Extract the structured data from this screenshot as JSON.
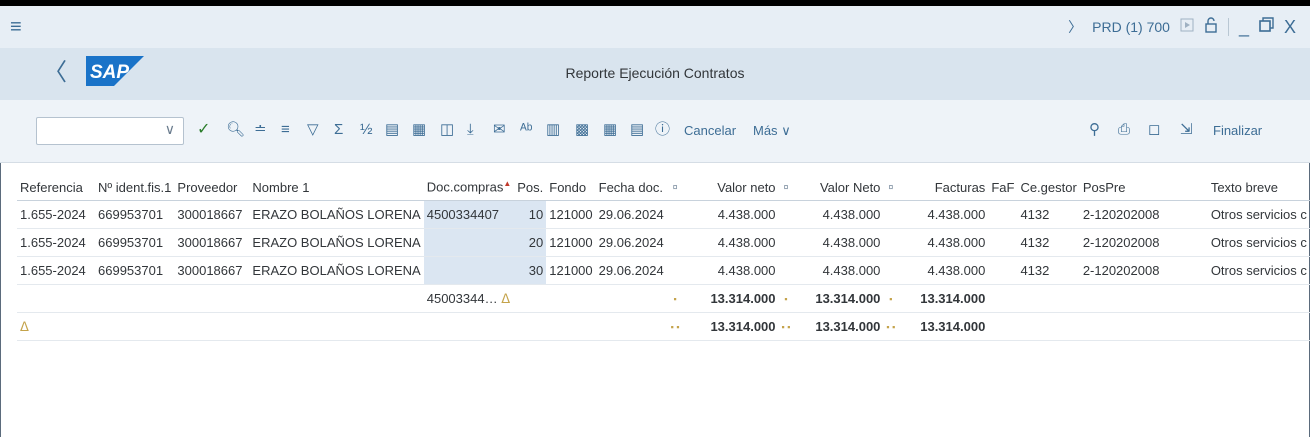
{
  "system": {
    "menu_icon": "hamburger-menu-icon",
    "chevron": "〉",
    "system_id": "PRD (1) 700",
    "icons": [
      "play-icon",
      "unlock-icon",
      "minimize-icon",
      "restore-icon",
      "close-icon"
    ],
    "minimize_glyph": "_",
    "close_glyph": "X"
  },
  "titlebar": {
    "back_glyph": "〈",
    "logo_text": "SAP",
    "title": "Reporte Ejecución Contratos"
  },
  "toolbar": {
    "command_value": "",
    "dropdown_glyph": "∨",
    "icons": [
      "check-icon",
      "find-icon",
      "sort-asc-icon",
      "sort-desc-icon",
      "filter-icon",
      "sum-icon",
      "subtotal-icon",
      "print-preview-icon",
      "export-icon",
      "word-icon",
      "download-icon",
      "email-icon",
      "abc-icon",
      "chart-icon",
      "grid-icon",
      "layout-icon",
      "variant-icon",
      "info-icon"
    ],
    "cancel_label": "Cancelar",
    "more_label": "Más",
    "more_chevron": "∨",
    "right_icons": [
      "search-icon",
      "print-icon",
      "screen-icon",
      "exit-icon"
    ],
    "exit_label": "Finalizar"
  },
  "table": {
    "columns": [
      "Referencia",
      "Nº ident.fis.1",
      "Proveedor",
      "Nombre 1",
      "Doc.compras",
      "Pos.",
      "Fondo",
      "Fecha doc.",
      "",
      "Valor neto",
      "",
      "Valor Neto",
      "",
      "Facturas",
      "FaF",
      "Ce.gestor",
      "PosPre",
      "Texto breve"
    ],
    "rows": [
      [
        "1.655-2024",
        "669953701",
        "300018667",
        "ERAZO BOLAÑOS LORENA",
        "4500334407",
        "10",
        "121000",
        "29.06.2024",
        "",
        "4.438.000",
        "",
        "4.438.000",
        "",
        "4.438.000",
        "",
        "4132",
        "2-120202008",
        "Otros servicios c"
      ],
      [
        "1.655-2024",
        "669953701",
        "300018667",
        "ERAZO BOLAÑOS LORENA",
        "",
        "20",
        "121000",
        "29.06.2024",
        "",
        "4.438.000",
        "",
        "4.438.000",
        "",
        "4.438.000",
        "",
        "4132",
        "2-120202008",
        "Otros servicios c"
      ],
      [
        "1.655-2024",
        "669953701",
        "300018667",
        "ERAZO BOLAÑOS LORENA",
        "",
        "30",
        "121000",
        "29.06.2024",
        "",
        "4.438.000",
        "",
        "4.438.000",
        "",
        "4.438.000",
        "",
        "4132",
        "2-120202008",
        "Otros servicios c"
      ]
    ],
    "subtotal": {
      "doc": "45003344",
      "doc_ellipsis": "…",
      "valor_neto": "13.314.000",
      "valor_neto2": "13.314.000",
      "facturas": "13.314.000"
    },
    "total": {
      "valor_neto": "13.314.000",
      "valor_neto2": "13.314.000",
      "facturas": "13.314.000"
    },
    "sum_icon": "subtotal-sum-icon",
    "sort_mark": "▲",
    "col_mark": "¤",
    "dot_single": "▪",
    "dot_double": "▪ ▪"
  },
  "colors": {
    "sysbar": "#e7eef5",
    "titlebar": "#d9e4ee",
    "toolbar": "#eef3f8",
    "accent": "#3d6d95",
    "selection": "#dbe6f2",
    "total_marker": "#c4a34a",
    "sap_logo": "#1a73c8"
  }
}
